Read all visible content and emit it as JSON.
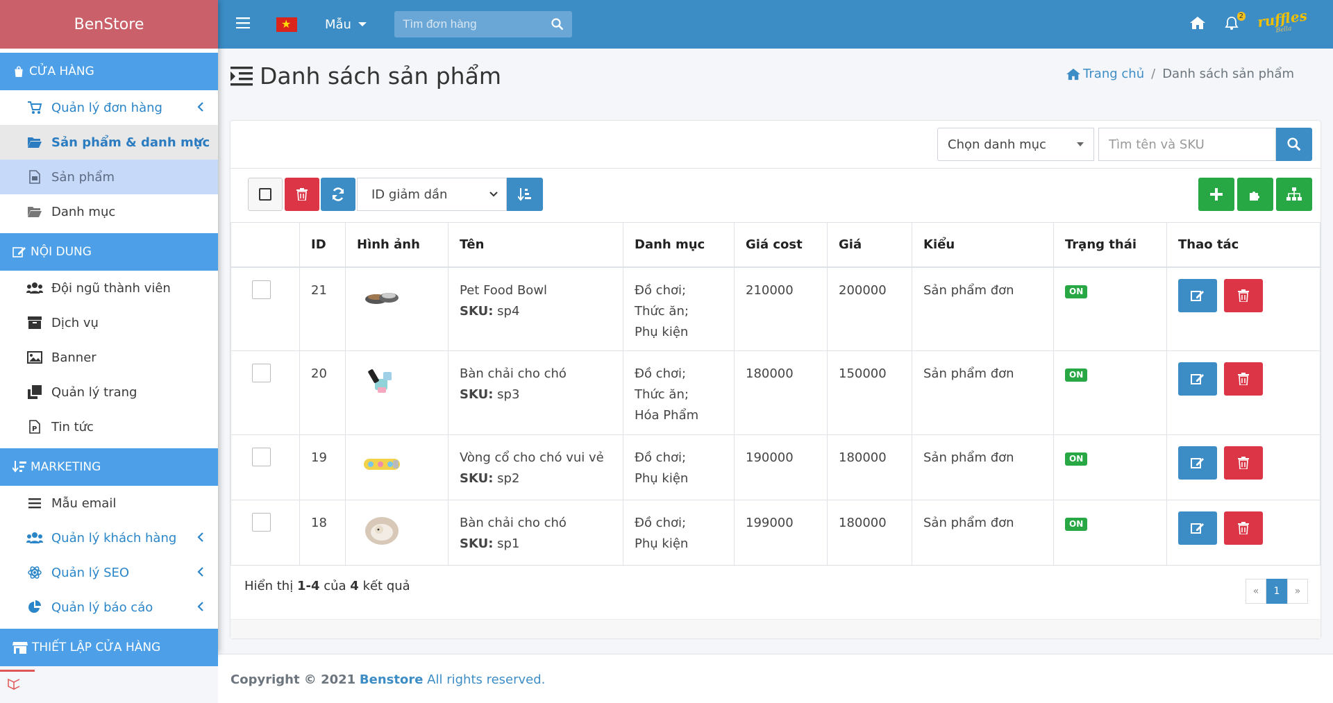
{
  "brand": "BenStore",
  "sidebar": {
    "sections": [
      {
        "title": "CỬA HÀNG"
      },
      {
        "title": "NỘI DUNG"
      },
      {
        "title": "MARKETING"
      },
      {
        "title": "THIẾT LẬP CỬA HÀNG"
      }
    ],
    "items": [
      {
        "label": "Quản lý đơn hàng"
      },
      {
        "label": "Sản phẩm & danh mục"
      },
      {
        "label": "Sản phẩm"
      },
      {
        "label": "Danh mục"
      },
      {
        "label": "Đội ngũ thành viên"
      },
      {
        "label": "Dịch vụ"
      },
      {
        "label": "Banner"
      },
      {
        "label": "Quản lý trang"
      },
      {
        "label": "Tin tức"
      },
      {
        "label": "Mẫu email"
      },
      {
        "label": "Quản lý khách hàng"
      },
      {
        "label": "Quản lý SEO"
      },
      {
        "label": "Quản lý báo cáo"
      }
    ]
  },
  "topbar": {
    "template_label": "Mẫu",
    "search_placeholder": "Tìm đơn hàng",
    "notification_count": "2",
    "logo_text": "ruffles",
    "logo_sub": "Bella"
  },
  "page": {
    "title": "Danh sách sản phẩm",
    "breadcrumb_home": "Trang chủ",
    "breadcrumb_current": "Danh sách sản phẩm"
  },
  "filters": {
    "category_select": "Chọn danh mục",
    "search_placeholder": "Tìm tên và SKU",
    "sort_select": "ID giảm dần"
  },
  "table": {
    "headers": [
      "ID",
      "Hình ảnh",
      "Tên",
      "Danh mục",
      "Giá cost",
      "Giá",
      "Kiểu",
      "Trạng thái",
      "Thao tác"
    ],
    "sku_label": "SKU:",
    "rows": [
      {
        "id": "21",
        "name": "Pet Food Bowl",
        "sku": "sp4",
        "cat1": "Đồ chơi;",
        "cat2": "Thức ăn;",
        "cat3": "Phụ kiện",
        "cost": "210000",
        "price": "200000",
        "type": "Sản phẩm đơn",
        "status": "ON"
      },
      {
        "id": "20",
        "name": "Bàn chải cho chó",
        "sku": "sp3",
        "cat1": "Đồ chơi;",
        "cat2": "Thức ăn;",
        "cat3": "Hóa Phẩm",
        "cost": "180000",
        "price": "150000",
        "type": "Sản phẩm đơn",
        "status": "ON"
      },
      {
        "id": "19",
        "name": "Vòng cổ cho chó vui vẻ",
        "sku": "sp2",
        "cat1": "Đồ chơi;",
        "cat2": "Phụ kiện",
        "cat3": "",
        "cost": "190000",
        "price": "180000",
        "type": "Sản phẩm đơn",
        "status": "ON"
      },
      {
        "id": "18",
        "name": "Bàn chải cho chó",
        "sku": "sp1",
        "cat1": "Đồ chơi;",
        "cat2": "Phụ kiện",
        "cat3": "",
        "cost": "199000",
        "price": "180000",
        "type": "Sản phẩm đơn",
        "status": "ON"
      }
    ]
  },
  "summary": {
    "prefix": "Hiển thị",
    "range": "1-4",
    "of": "của",
    "total": "4",
    "suffix": "kết quả"
  },
  "pagination": {
    "prev": "«",
    "current": "1",
    "next": "»"
  },
  "footer": {
    "copyright": "Copyright © 2021",
    "brand": "Benstore",
    "rights": "All rights reserved."
  }
}
